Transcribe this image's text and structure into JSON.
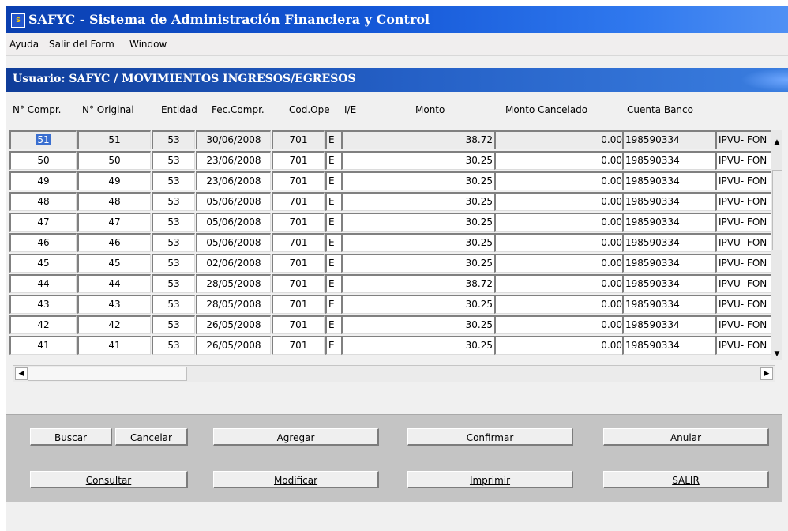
{
  "window": {
    "title": "SAFYC - Sistema de Administración Financiera y Control",
    "icon_text": "S"
  },
  "menu": [
    "Ayuda",
    "Salir del Form",
    "Window"
  ],
  "header": {
    "text": "Usuario: SAFYC   /   MOVIMIENTOS INGRESOS/EGRESOS"
  },
  "columns": [
    "N° Compr.",
    "N° Original",
    "Entidad",
    "Fec.Compr.",
    "Cod.Ope",
    "I/E",
    "Monto",
    "Monto Cancelado",
    "Cuenta Banco"
  ],
  "rows": [
    {
      "compr": "51",
      "original": "51",
      "entidad": "53",
      "fecha": "30/06/2008",
      "codope": "701",
      "ie": "E",
      "monto": "38.72",
      "cancelado": "0.00",
      "cuenta": "198590334",
      "banco": "IPVU- FON"
    },
    {
      "compr": "50",
      "original": "50",
      "entidad": "53",
      "fecha": "23/06/2008",
      "codope": "701",
      "ie": "E",
      "monto": "30.25",
      "cancelado": "0.00",
      "cuenta": "198590334",
      "banco": "IPVU- FON"
    },
    {
      "compr": "49",
      "original": "49",
      "entidad": "53",
      "fecha": "23/06/2008",
      "codope": "701",
      "ie": "E",
      "monto": "30.25",
      "cancelado": "0.00",
      "cuenta": "198590334",
      "banco": "IPVU- FON"
    },
    {
      "compr": "48",
      "original": "48",
      "entidad": "53",
      "fecha": "05/06/2008",
      "codope": "701",
      "ie": "E",
      "monto": "30.25",
      "cancelado": "0.00",
      "cuenta": "198590334",
      "banco": "IPVU- FON"
    },
    {
      "compr": "47",
      "original": "47",
      "entidad": "53",
      "fecha": "05/06/2008",
      "codope": "701",
      "ie": "E",
      "monto": "30.25",
      "cancelado": "0.00",
      "cuenta": "198590334",
      "banco": "IPVU- FON"
    },
    {
      "compr": "46",
      "original": "46",
      "entidad": "53",
      "fecha": "05/06/2008",
      "codope": "701",
      "ie": "E",
      "monto": "30.25",
      "cancelado": "0.00",
      "cuenta": "198590334",
      "banco": "IPVU- FON"
    },
    {
      "compr": "45",
      "original": "45",
      "entidad": "53",
      "fecha": "02/06/2008",
      "codope": "701",
      "ie": "E",
      "monto": "30.25",
      "cancelado": "0.00",
      "cuenta": "198590334",
      "banco": "IPVU- FON"
    },
    {
      "compr": "44",
      "original": "44",
      "entidad": "53",
      "fecha": "28/05/2008",
      "codope": "701",
      "ie": "E",
      "monto": "38.72",
      "cancelado": "0.00",
      "cuenta": "198590334",
      "banco": "IPVU- FON"
    },
    {
      "compr": "43",
      "original": "43",
      "entidad": "53",
      "fecha": "28/05/2008",
      "codope": "701",
      "ie": "E",
      "monto": "30.25",
      "cancelado": "0.00",
      "cuenta": "198590334",
      "banco": "IPVU- FON"
    },
    {
      "compr": "42",
      "original": "42",
      "entidad": "53",
      "fecha": "26/05/2008",
      "codope": "701",
      "ie": "E",
      "monto": "30.25",
      "cancelado": "0.00",
      "cuenta": "198590334",
      "banco": "IPVU- FON"
    },
    {
      "compr": "41",
      "original": "41",
      "entidad": "53",
      "fecha": "26/05/2008",
      "codope": "701",
      "ie": "E",
      "monto": "30.25",
      "cancelado": "0.00",
      "cuenta": "198590334",
      "banco": "IPVU- FON"
    }
  ],
  "buttons": {
    "buscar": "Buscar",
    "cancelar": "Cancelar",
    "agregar": "Agregar",
    "confirmar": "Confirmar",
    "anular": "Anular",
    "consultar": "Consultar",
    "modificar": "Modificar",
    "imprimir": "Imprimir",
    "salir": "SALIR"
  },
  "colors": {
    "title_bar": "#1356d6",
    "header_band": "#245fc5",
    "button_panel": "#c4c4c4",
    "selection": "#3a6fd0"
  }
}
